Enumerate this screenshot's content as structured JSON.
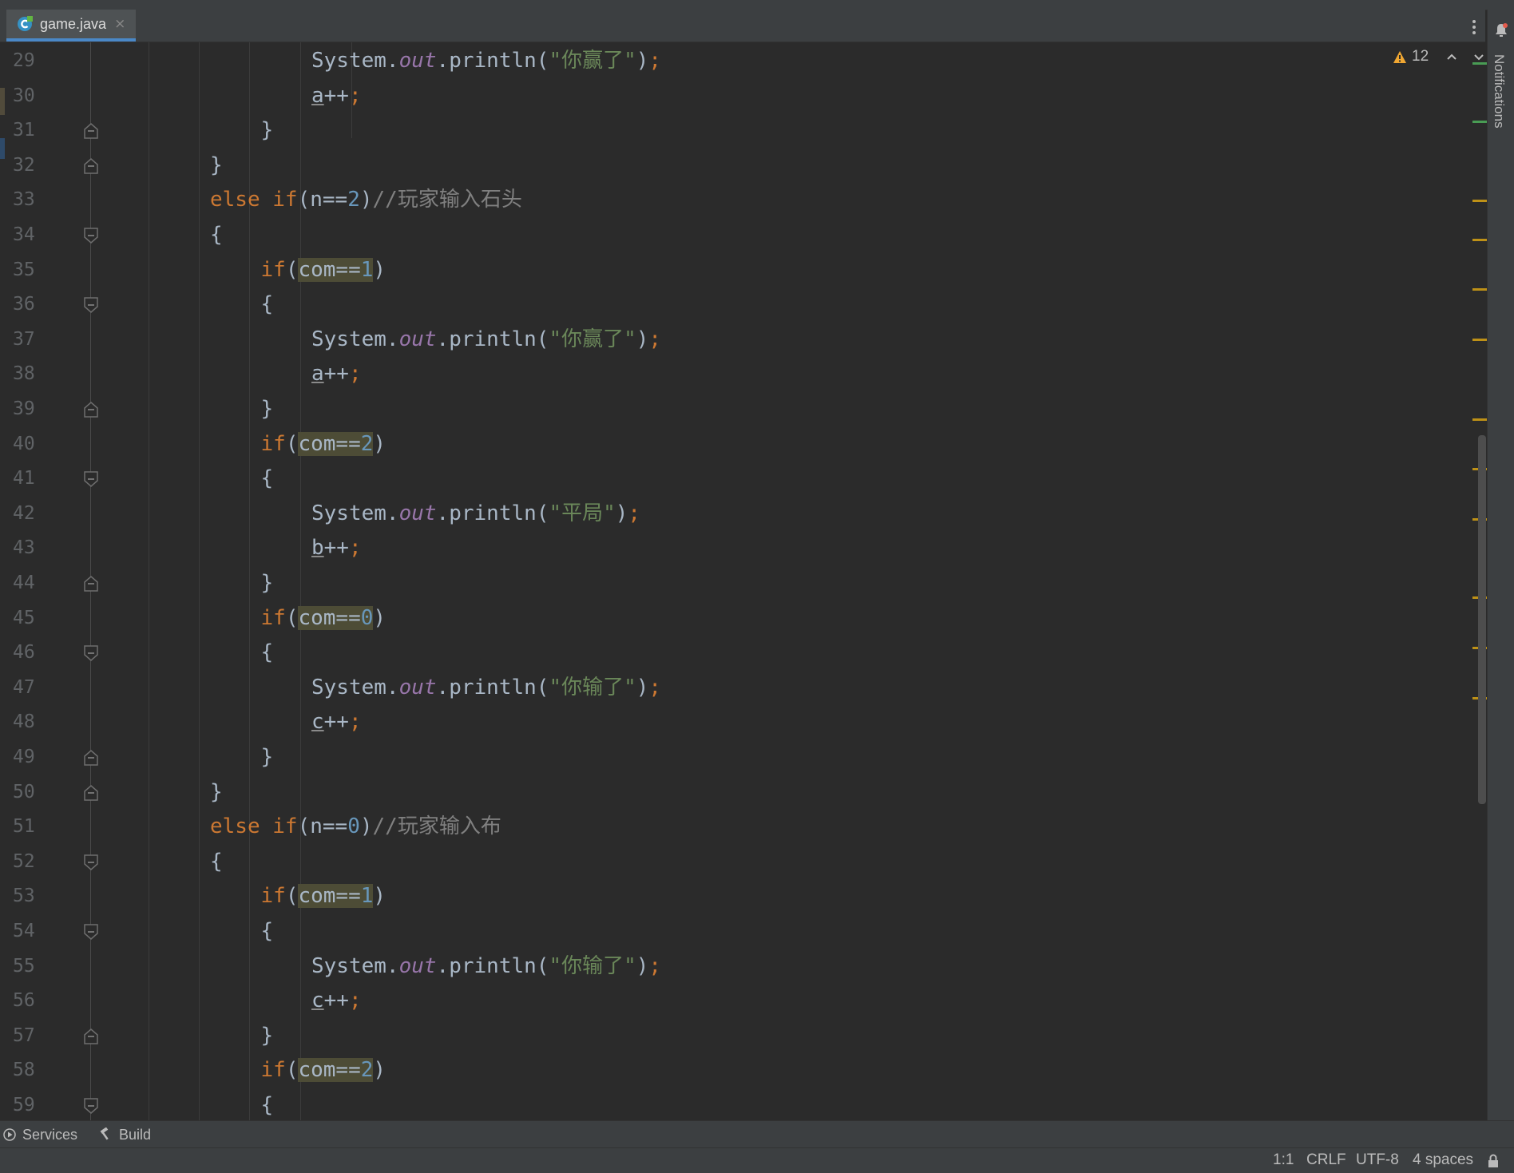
{
  "tab": {
    "filename": "game.java",
    "close": "×"
  },
  "inspections": {
    "warnings": "12"
  },
  "sidebar_right": {
    "notifications": "Notifications"
  },
  "tool_windows": [
    {
      "label": "Services"
    },
    {
      "label": "Build"
    }
  ],
  "status": {
    "position": "1:1",
    "line_sep": "CRLF",
    "encoding": "UTF-8",
    "indent": "4 spaces"
  },
  "colors": {
    "keyword": "#cc7832",
    "number": "#6897bb",
    "string": "#6a8759",
    "comment": "#808080",
    "field": "#9876aa",
    "text": "#a9b7c6",
    "background": "#2b2b2b",
    "match_highlight": "#4d4c36",
    "warning": "#be9117"
  },
  "code": {
    "lines": [
      {
        "n": "29",
        "indent": 3,
        "tokens": [
          [
            "t",
            "System."
          ],
          [
            "f",
            "out"
          ],
          [
            "t",
            ".println("
          ],
          [
            "s",
            "\"你赢了\""
          ],
          [
            "t",
            ")"
          ],
          [
            "p",
            ";"
          ]
        ]
      },
      {
        "n": "30",
        "indent": 3,
        "tokens": [
          [
            "u",
            "a"
          ],
          [
            "t",
            "++"
          ],
          [
            "p",
            ";"
          ]
        ]
      },
      {
        "n": "31",
        "indent": 2,
        "tokens": [
          [
            "t",
            "}"
          ]
        ]
      },
      {
        "n": "32",
        "indent": 1,
        "tokens": [
          [
            "t",
            "}"
          ]
        ]
      },
      {
        "n": "33",
        "indent": 1,
        "tokens": [
          [
            "k",
            "else "
          ],
          [
            "k",
            "if"
          ],
          [
            "t",
            "(n=="
          ],
          [
            "n",
            "2"
          ],
          [
            "t",
            ")"
          ],
          [
            "c",
            "//玩家输入石头"
          ]
        ]
      },
      {
        "n": "34",
        "indent": 1,
        "tokens": [
          [
            "t",
            "{"
          ]
        ]
      },
      {
        "n": "35",
        "indent": 2,
        "tokens": [
          [
            "k",
            "if"
          ],
          [
            "t",
            "("
          ],
          [
            "h",
            "com=="
          ],
          [
            "hn",
            "1"
          ],
          [
            "t",
            ")"
          ]
        ]
      },
      {
        "n": "36",
        "indent": 2,
        "tokens": [
          [
            "t",
            "{"
          ]
        ]
      },
      {
        "n": "37",
        "indent": 3,
        "tokens": [
          [
            "t",
            "System."
          ],
          [
            "f",
            "out"
          ],
          [
            "t",
            ".println("
          ],
          [
            "s",
            "\"你赢了\""
          ],
          [
            "t",
            ")"
          ],
          [
            "p",
            ";"
          ]
        ]
      },
      {
        "n": "38",
        "indent": 3,
        "tokens": [
          [
            "u",
            "a"
          ],
          [
            "t",
            "++"
          ],
          [
            "p",
            ";"
          ]
        ]
      },
      {
        "n": "39",
        "indent": 2,
        "tokens": [
          [
            "t",
            "}"
          ]
        ]
      },
      {
        "n": "40",
        "indent": 2,
        "tokens": [
          [
            "k",
            "if"
          ],
          [
            "t",
            "("
          ],
          [
            "h",
            "com=="
          ],
          [
            "hn",
            "2"
          ],
          [
            "t",
            ")"
          ]
        ]
      },
      {
        "n": "41",
        "indent": 2,
        "tokens": [
          [
            "t",
            "{"
          ]
        ]
      },
      {
        "n": "42",
        "indent": 3,
        "tokens": [
          [
            "t",
            "System."
          ],
          [
            "f",
            "out"
          ],
          [
            "t",
            ".println("
          ],
          [
            "s",
            "\"平局\""
          ],
          [
            "t",
            ")"
          ],
          [
            "p",
            ";"
          ]
        ]
      },
      {
        "n": "43",
        "indent": 3,
        "tokens": [
          [
            "u",
            "b"
          ],
          [
            "t",
            "++"
          ],
          [
            "p",
            ";"
          ]
        ]
      },
      {
        "n": "44",
        "indent": 2,
        "tokens": [
          [
            "t",
            "}"
          ]
        ]
      },
      {
        "n": "45",
        "indent": 2,
        "tokens": [
          [
            "k",
            "if"
          ],
          [
            "t",
            "("
          ],
          [
            "h",
            "com=="
          ],
          [
            "hn",
            "0"
          ],
          [
            "t",
            ")"
          ]
        ]
      },
      {
        "n": "46",
        "indent": 2,
        "tokens": [
          [
            "t",
            "{"
          ]
        ]
      },
      {
        "n": "47",
        "indent": 3,
        "tokens": [
          [
            "t",
            "System."
          ],
          [
            "f",
            "out"
          ],
          [
            "t",
            ".println("
          ],
          [
            "s",
            "\"你输了\""
          ],
          [
            "t",
            ")"
          ],
          [
            "p",
            ";"
          ]
        ]
      },
      {
        "n": "48",
        "indent": 3,
        "tokens": [
          [
            "u",
            "c"
          ],
          [
            "t",
            "++"
          ],
          [
            "p",
            ";"
          ]
        ]
      },
      {
        "n": "49",
        "indent": 2,
        "tokens": [
          [
            "t",
            "}"
          ]
        ]
      },
      {
        "n": "50",
        "indent": 1,
        "tokens": [
          [
            "t",
            "}"
          ]
        ]
      },
      {
        "n": "51",
        "indent": 1,
        "tokens": [
          [
            "k",
            "else "
          ],
          [
            "k",
            "if"
          ],
          [
            "t",
            "(n=="
          ],
          [
            "n",
            "0"
          ],
          [
            "t",
            ")"
          ],
          [
            "c",
            "//玩家输入布"
          ]
        ]
      },
      {
        "n": "52",
        "indent": 1,
        "tokens": [
          [
            "t",
            "{"
          ]
        ]
      },
      {
        "n": "53",
        "indent": 2,
        "tokens": [
          [
            "k",
            "if"
          ],
          [
            "t",
            "("
          ],
          [
            "h",
            "com=="
          ],
          [
            "hn",
            "1"
          ],
          [
            "t",
            ")"
          ]
        ]
      },
      {
        "n": "54",
        "indent": 2,
        "tokens": [
          [
            "t",
            "{"
          ]
        ]
      },
      {
        "n": "55",
        "indent": 3,
        "tokens": [
          [
            "t",
            "System."
          ],
          [
            "f",
            "out"
          ],
          [
            "t",
            ".println("
          ],
          [
            "s",
            "\"你输了\""
          ],
          [
            "t",
            ")"
          ],
          [
            "p",
            ";"
          ]
        ]
      },
      {
        "n": "56",
        "indent": 3,
        "tokens": [
          [
            "u",
            "c"
          ],
          [
            "t",
            "++"
          ],
          [
            "p",
            ";"
          ]
        ]
      },
      {
        "n": "57",
        "indent": 2,
        "tokens": [
          [
            "t",
            "}"
          ]
        ]
      },
      {
        "n": "58",
        "indent": 2,
        "tokens": [
          [
            "k",
            "if"
          ],
          [
            "t",
            "("
          ],
          [
            "h",
            "com=="
          ],
          [
            "hn",
            "2"
          ],
          [
            "t",
            ")"
          ]
        ]
      },
      {
        "n": "59",
        "indent": 2,
        "tokens": [
          [
            "t",
            "{"
          ]
        ]
      }
    ]
  }
}
